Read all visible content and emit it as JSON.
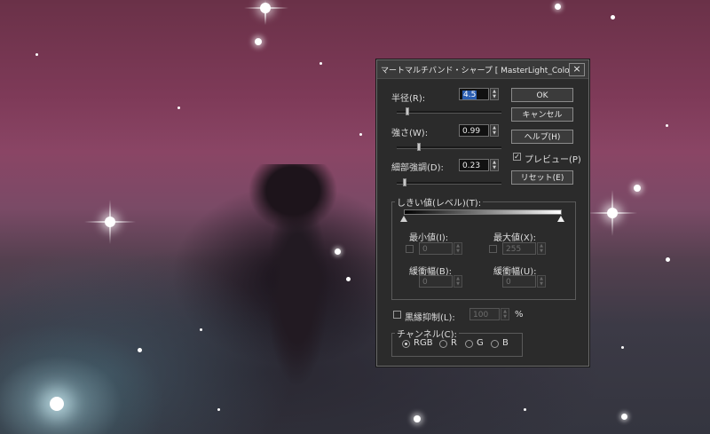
{
  "dialog": {
    "title": "マートマルチバンド・シャープ [ MasterLight_Color_Ma",
    "close_label": "×",
    "radius": {
      "label": "半径(R):",
      "value": "4.5"
    },
    "strength": {
      "label": "強さ(W):",
      "value": "0.99"
    },
    "detail": {
      "label": "細部強調(D):",
      "value": "0.23"
    },
    "buttons": {
      "ok": "OK",
      "cancel": "キャンセル",
      "help": "ヘルプ(H)",
      "reset": "リセット(E)"
    },
    "preview": {
      "label": "プレビュー(P)",
      "checked": true
    },
    "threshold": {
      "label": "しきい値(レベル)(T):",
      "min_label": "最小値(I):",
      "min_value": "0",
      "max_label": "最大値(X):",
      "max_value": "255",
      "buffer_low_label": "緩衝幅(B):",
      "buffer_low_value": "0",
      "buffer_high_label": "緩衝幅(U):",
      "buffer_high_value": "0"
    },
    "black_edge": {
      "label": "黒縁抑制(L):",
      "value": "100",
      "unit": "%"
    },
    "channel": {
      "label": "チャンネル(C):",
      "options": [
        "RGB",
        "R",
        "G",
        "B"
      ],
      "selected": "RGB"
    }
  }
}
